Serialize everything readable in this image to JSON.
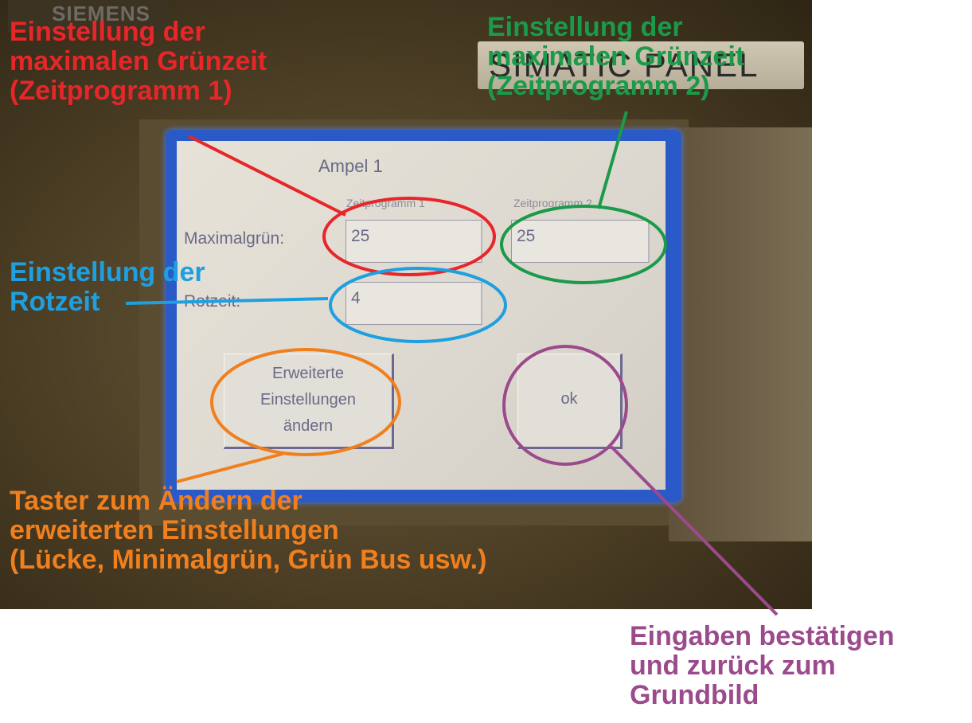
{
  "device": {
    "brand": "SIEMENS",
    "model_plate": "SIMATIC PANEL"
  },
  "hmi": {
    "title": "Ampel 1",
    "column_labels": [
      "Zeitprogramm 1",
      "Zeitprogramm 2"
    ],
    "maximalgruen": {
      "label": "Maximalgrün:",
      "program1": "25",
      "program2": "25"
    },
    "rotzeit": {
      "label": "Rotzeit:",
      "value": "4"
    },
    "btn_advanced": [
      "Erweiterte",
      "Einstellungen",
      "ändern"
    ],
    "btn_ok": "ok"
  },
  "annotations": {
    "red": {
      "lines": [
        "Einstellung der",
        "maximalen Grünzeit",
        "(Zeitprogramm 1)"
      ],
      "color": "#e8262a"
    },
    "green": {
      "lines": [
        "Einstellung der",
        "maximalen Grünzeit",
        "(Zeitprogramm 2)"
      ],
      "color": "#1b9a49"
    },
    "blue": {
      "lines": [
        "Einstellung der",
        "Rotzeit"
      ],
      "color": "#1ea0e0"
    },
    "orange": {
      "lines": [
        "Taster zum Ändern der",
        "erweiterten Einstellungen",
        "(Lücke, Minimalgrün, Grün Bus usw.)"
      ],
      "color": "#f07f1e"
    },
    "purple": {
      "lines": [
        "Eingaben bestätigen",
        "und zurück zum",
        "Grundbild"
      ],
      "color": "#9b4a8c"
    }
  }
}
